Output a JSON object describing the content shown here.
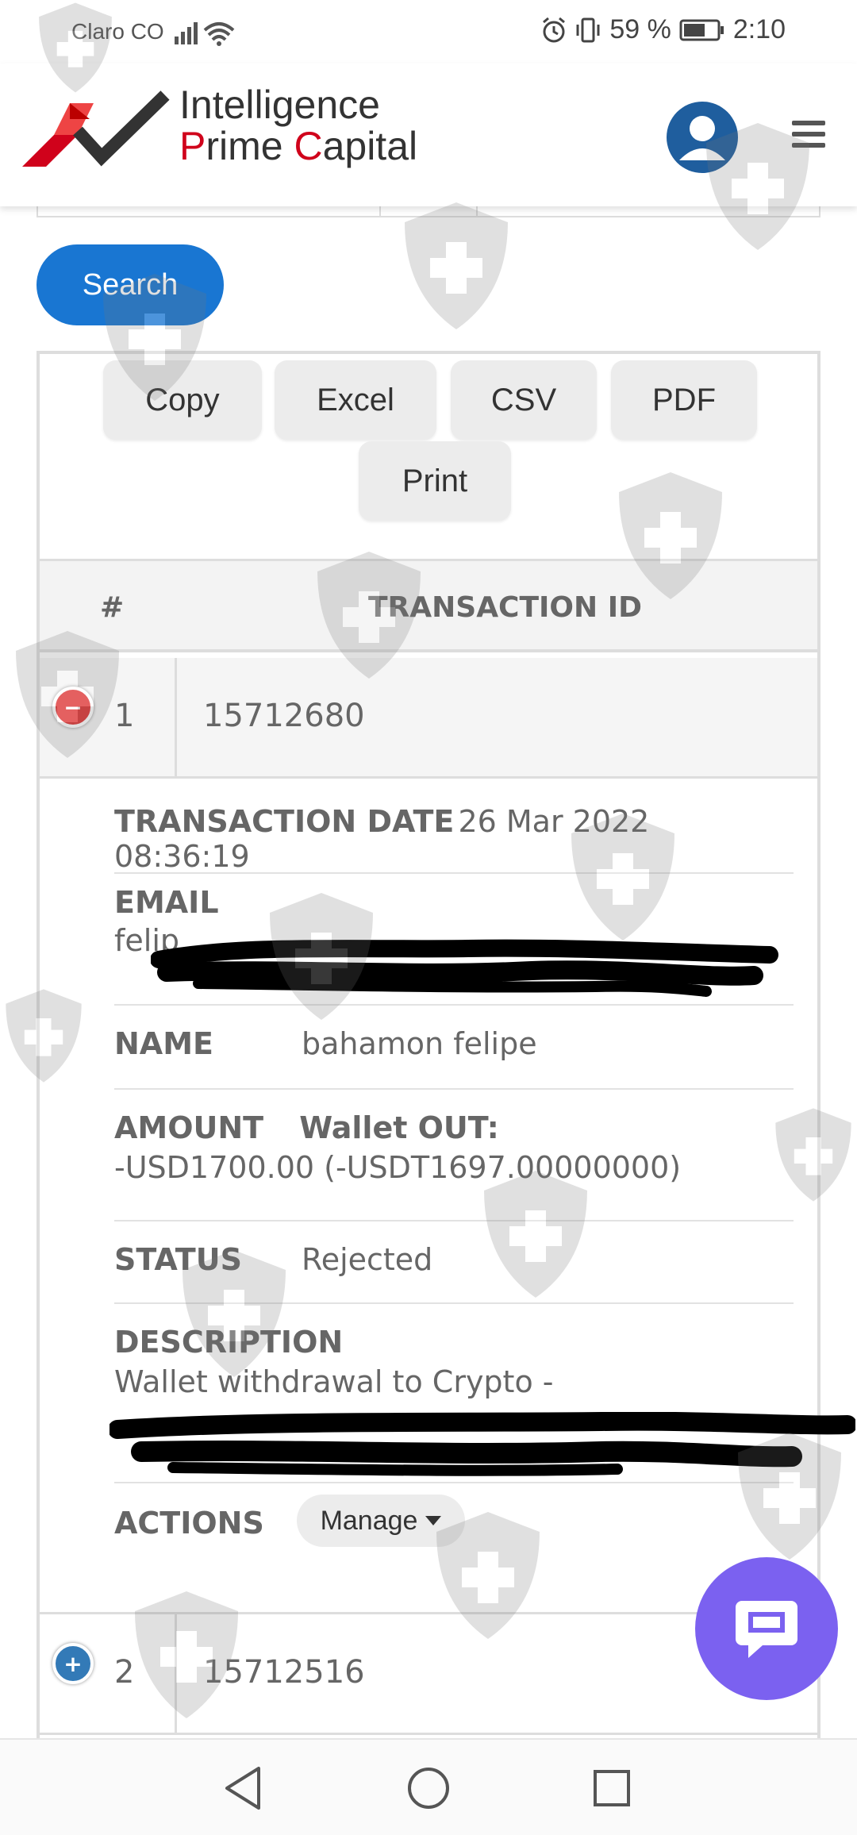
{
  "status_bar": {
    "carrier": "Claro CO",
    "battery": "59 %",
    "time": "2:10"
  },
  "header": {
    "brand_line1": "Intelligence",
    "brand_line2_parts": [
      "P",
      "rime ",
      "C",
      "apital"
    ],
    "menu_icon": "hamburger-icon",
    "user_icon": "user-avatar-icon"
  },
  "search": {
    "label": "Search"
  },
  "export_buttons": [
    "Copy",
    "Excel",
    "CSV",
    "PDF",
    "Print"
  ],
  "table": {
    "headers": [
      "#",
      "TRANSACTION ID"
    ],
    "rows": [
      {
        "num": "1",
        "transaction_id": "15712680",
        "expanded": true
      },
      {
        "num": "2",
        "transaction_id": "15712516",
        "expanded": false
      }
    ],
    "details": {
      "transaction_date_label": "TRANSACTION DATE",
      "transaction_date_value": "26 Mar 2022 08:36:19",
      "email_label": "EMAIL",
      "email_value": "felip",
      "name_label": "NAME",
      "name_value": "bahamon felipe",
      "amount_label": "AMOUNT",
      "amount_sublabel": "Wallet OUT:",
      "amount_value": "-USD1700.00 (-USDT1697.00000000)",
      "status_label": "STATUS",
      "status_value": "Rejected",
      "description_label": "DESCRIPTION",
      "description_value": "Wallet withdrawal to Crypto -",
      "actions_label": "ACTIONS",
      "manage_label": "Manage"
    }
  },
  "colors": {
    "primary": "#1976d2",
    "brand_red": "#d0021b",
    "collapse_red": "#dd3333",
    "expand_blue": "#337ab7",
    "chat_purple": "#7b61f0"
  }
}
